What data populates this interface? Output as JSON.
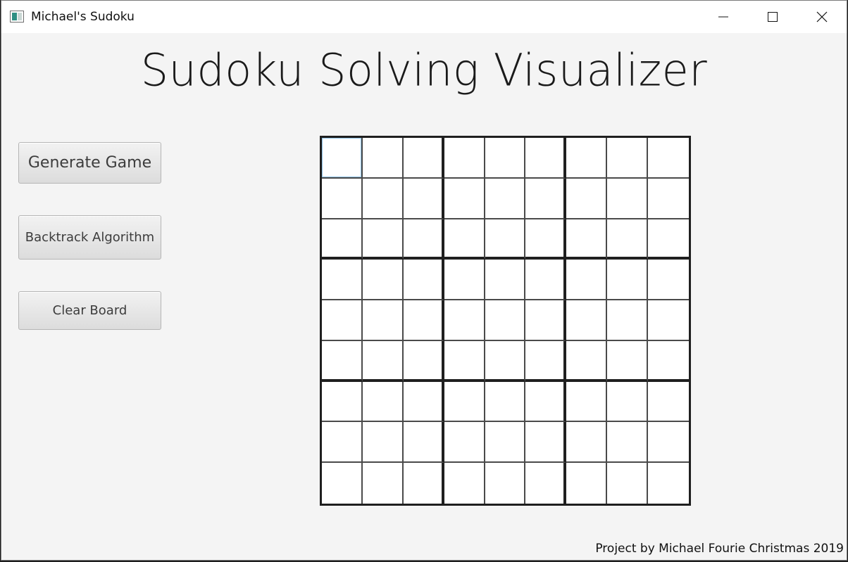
{
  "window": {
    "title": "Michael's Sudoku",
    "icon": "app-window-icon",
    "controls": [
      "minimize-icon",
      "maximize-icon",
      "close-icon"
    ]
  },
  "header": {
    "title": "Sudoku Solving Visualizer"
  },
  "controls": {
    "generate_label": "Generate Game",
    "backtrack_label": "Backtrack Algorithm",
    "clear_label": "Clear Board"
  },
  "board": {
    "size": 9,
    "box_size": 3,
    "selected_cell": [
      0,
      0
    ],
    "cells": [
      [
        "",
        "",
        "",
        "",
        "",
        "",
        "",
        "",
        ""
      ],
      [
        "",
        "",
        "",
        "",
        "",
        "",
        "",
        "",
        ""
      ],
      [
        "",
        "",
        "",
        "",
        "",
        "",
        "",
        "",
        ""
      ],
      [
        "",
        "",
        "",
        "",
        "",
        "",
        "",
        "",
        ""
      ],
      [
        "",
        "",
        "",
        "",
        "",
        "",
        "",
        "",
        ""
      ],
      [
        "",
        "",
        "",
        "",
        "",
        "",
        "",
        "",
        ""
      ],
      [
        "",
        "",
        "",
        "",
        "",
        "",
        "",
        "",
        ""
      ],
      [
        "",
        "",
        "",
        "",
        "",
        "",
        "",
        "",
        ""
      ],
      [
        "",
        "",
        "",
        "",
        "",
        "",
        "",
        "",
        ""
      ]
    ]
  },
  "footer": {
    "credit": "Project by Michael Fourie Christmas 2019"
  },
  "colors": {
    "background": "#f4f4f4",
    "grid_line": "#4a4a4a",
    "box_line": "#1f1f1f",
    "selection": "#8fc4e8"
  }
}
